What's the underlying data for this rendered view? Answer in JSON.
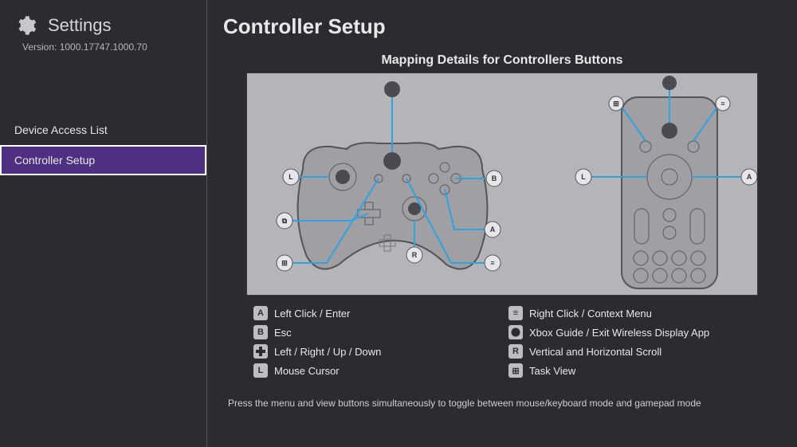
{
  "sidebar": {
    "title": "Settings",
    "version": "Version: 1000.17747.1000.70",
    "items": [
      {
        "label": "Device Access List",
        "selected": false
      },
      {
        "label": "Controller Setup",
        "selected": true
      }
    ]
  },
  "page": {
    "title": "Controller Setup",
    "subtitle": "Mapping Details for Controllers Buttons",
    "footer": "Press the menu and view buttons simultaneously to toggle between mouse/keyboard mode and gamepad mode"
  },
  "legend": {
    "left": [
      {
        "icon": "A",
        "text": "Left Click / Enter"
      },
      {
        "icon": "B",
        "text": "Esc"
      },
      {
        "icon": "dpad",
        "text": "Left / Right / Up / Down"
      },
      {
        "icon": "L",
        "text": "Mouse Cursor"
      }
    ],
    "right": [
      {
        "icon": "menu",
        "text": "Right Click / Context Menu"
      },
      {
        "icon": "xbox",
        "text": "Xbox Guide / Exit Wireless Display App"
      },
      {
        "icon": "R",
        "text": "Vertical and Horizontal Scroll"
      },
      {
        "icon": "view",
        "text": "Task View"
      }
    ]
  },
  "diagram": {
    "controller_badges": [
      "L",
      "B",
      "A",
      "R",
      "view",
      "menu",
      "xbox"
    ],
    "remote_badges": [
      "view",
      "xbox",
      "menu",
      "L",
      "A"
    ]
  }
}
